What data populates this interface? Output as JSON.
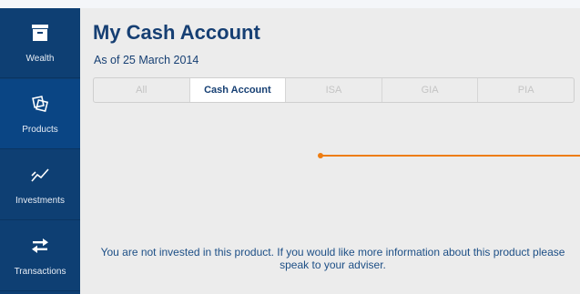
{
  "sidebar": {
    "items": [
      {
        "label": "Wealth",
        "icon": "wealth-box-icon",
        "active": false
      },
      {
        "label": "Products",
        "icon": "products-icon",
        "active": true
      },
      {
        "label": "Investments",
        "icon": "investments-chart-icon",
        "active": false
      },
      {
        "label": "Transactions",
        "icon": "transactions-arrows-icon",
        "active": false
      }
    ]
  },
  "header": {
    "title": "My Cash Account",
    "subtitle": "As of 25 March 2014"
  },
  "tabs": [
    {
      "label": "All",
      "active": false
    },
    {
      "label": "Cash Account",
      "active": true
    },
    {
      "label": "ISA",
      "active": false
    },
    {
      "label": "GIA",
      "active": false
    },
    {
      "label": "PIA",
      "active": false
    }
  ],
  "message": "You are not invested in this product. If you would like more information about this product please speak to your adviser.",
  "colors": {
    "sidebar": "#0e3f73",
    "accent": "#ee7d12",
    "title": "#163f73"
  }
}
